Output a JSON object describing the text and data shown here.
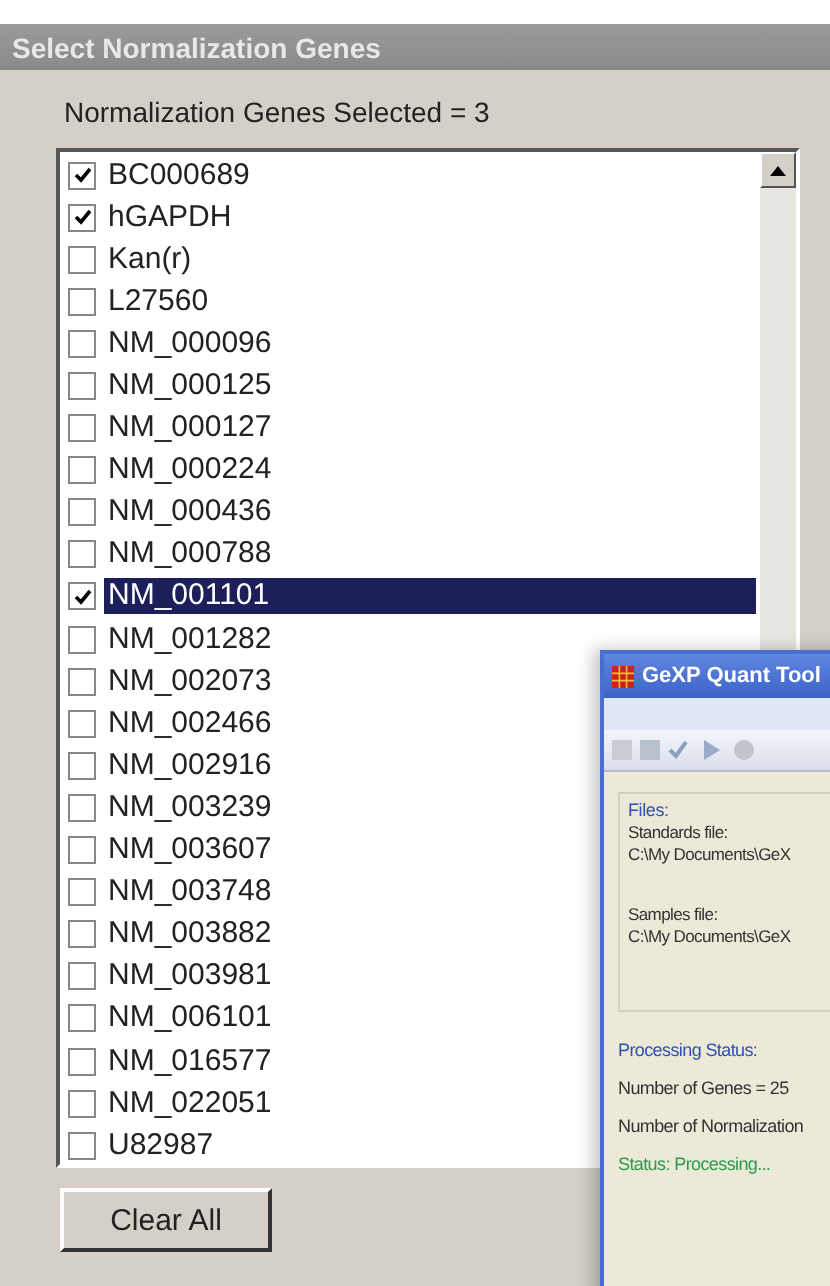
{
  "dialog": {
    "title": "Select Normalization Genes",
    "summary": "Normalization Genes Selected = 3",
    "genes": [
      {
        "label": "BC000689",
        "checked": true,
        "selected": false
      },
      {
        "label": "hGAPDH",
        "checked": true,
        "selected": false
      },
      {
        "label": "Kan(r)",
        "checked": false,
        "selected": false
      },
      {
        "label": "L27560",
        "checked": false,
        "selected": false
      },
      {
        "label": "NM_000096",
        "checked": false,
        "selected": false
      },
      {
        "label": "NM_000125",
        "checked": false,
        "selected": false
      },
      {
        "label": "NM_000127",
        "checked": false,
        "selected": false
      },
      {
        "label": "NM_000224",
        "checked": false,
        "selected": false
      },
      {
        "label": "NM_000436",
        "checked": false,
        "selected": false
      },
      {
        "label": "NM_000788",
        "checked": false,
        "selected": false
      },
      {
        "label": "NM_001101",
        "checked": true,
        "selected": true
      },
      {
        "label": "NM_001282",
        "checked": false,
        "selected": false
      },
      {
        "label": "NM_002073",
        "checked": false,
        "selected": false
      },
      {
        "label": "NM_002466",
        "checked": false,
        "selected": false
      },
      {
        "label": "NM_002916",
        "checked": false,
        "selected": false
      },
      {
        "label": "NM_003239",
        "checked": false,
        "selected": false
      },
      {
        "label": "NM_003607",
        "checked": false,
        "selected": false
      },
      {
        "label": "NM_003748",
        "checked": false,
        "selected": false
      },
      {
        "label": "NM_003882",
        "checked": false,
        "selected": false
      },
      {
        "label": "NM_003981",
        "checked": false,
        "selected": false
      },
      {
        "label": "NM_006101",
        "checked": false,
        "selected": false
      },
      {
        "label": "NM_016577",
        "checked": false,
        "selected": false
      },
      {
        "label": "NM_022051",
        "checked": false,
        "selected": false
      },
      {
        "label": "U82987",
        "checked": false,
        "selected": false
      }
    ],
    "button": "Clear All"
  },
  "quant_window": {
    "title": "GeXP Quant Tool",
    "files_heading": "Files:",
    "standards_label": "Standards file:",
    "standards_path": "C:\\My Documents\\GeX",
    "samples_label": "Samples file:",
    "samples_path": "C:\\My Documents\\GeX",
    "status_heading": "Processing Status:",
    "genes_count": "Number of Genes = 25",
    "norm_count": "Number of Normalization",
    "status": "Status: Processing..."
  }
}
